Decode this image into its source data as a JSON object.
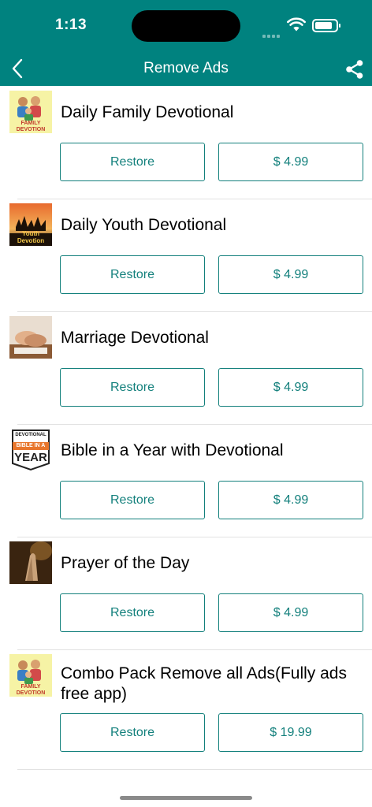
{
  "status": {
    "time": "1:13"
  },
  "nav": {
    "title": "Remove Ads",
    "back_icon": "chevron-left-icon",
    "share_icon": "share-icon"
  },
  "colors": {
    "primary": "#00827f",
    "button_border": "#13807c",
    "divider": "#e2e2e2"
  },
  "products": [
    {
      "title": "Daily Family Devotional",
      "thumbnail": "family-devotion-logo",
      "thumb_text": "FAMILY DEVOTION",
      "restore_label": "Restore",
      "price": "$ 4.99"
    },
    {
      "title": "Daily Youth Devotional",
      "thumbnail": "youth-devotion-logo",
      "thumb_text": "Youth Devotion",
      "restore_label": "Restore",
      "price": "$ 4.99"
    },
    {
      "title": "Marriage Devotional",
      "thumbnail": "marriage-hands-photo",
      "restore_label": "Restore",
      "price": "$ 4.99"
    },
    {
      "title": "Bible in a Year with Devotional",
      "thumbnail": "bible-in-a-year-logo",
      "thumb_text_top": "DEVOTIONAL",
      "thumb_text_mid": "BIBLE IN A",
      "thumb_text_bottom": "YEAR",
      "restore_label": "Restore",
      "price": "$ 4.99"
    },
    {
      "title": "Prayer of the Day",
      "thumbnail": "praying-hands-photo",
      "restore_label": "Restore",
      "price": "$ 4.99"
    },
    {
      "title": "Combo Pack Remove all Ads(Fully ads free app)",
      "thumbnail": "family-devotion-logo",
      "thumb_text": "FAMILY DEVOTION",
      "restore_label": "Restore",
      "price": "$ 19.99"
    }
  ]
}
